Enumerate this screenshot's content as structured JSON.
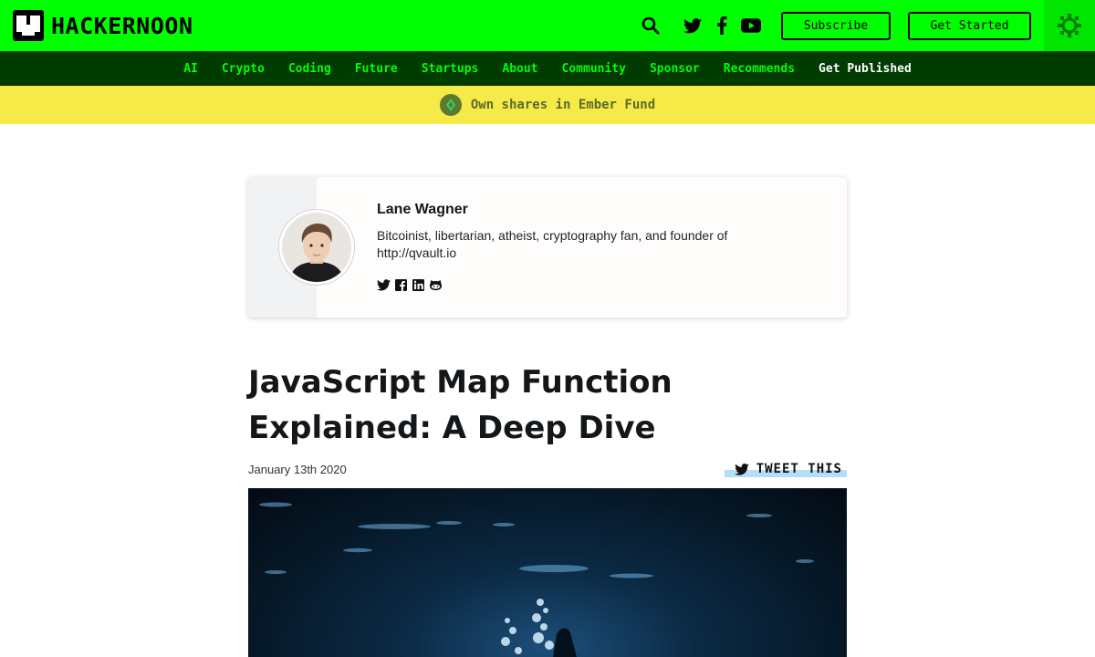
{
  "header": {
    "logo_text": "HACKERNOON",
    "icons": [
      "search-icon",
      "twitter-icon",
      "facebook-icon",
      "youtube-icon"
    ],
    "subscribe_label": "Subscribe",
    "get_started_label": "Get Started",
    "theme_icon": "sun-icon",
    "colors": {
      "brand": "#00ff00",
      "nav_bg": "#003b00",
      "promo_bg": "#f5ea47"
    }
  },
  "nav": {
    "items": [
      {
        "label": "AI"
      },
      {
        "label": "Crypto"
      },
      {
        "label": "Coding"
      },
      {
        "label": "Future"
      },
      {
        "label": "Startups"
      },
      {
        "label": "About"
      },
      {
        "label": "Community"
      },
      {
        "label": "Sponsor"
      },
      {
        "label": "Recommends"
      },
      {
        "label": "Get Published"
      }
    ]
  },
  "promo": {
    "icon": "ember-fund-icon",
    "text": "Own shares in Ember Fund"
  },
  "author": {
    "name": "Lane Wagner",
    "bio": "Bitcoinist, libertarian, atheist, cryptography fan, and founder of http://qvault.io",
    "social_icons": [
      "twitter-icon",
      "facebook-icon",
      "linkedin-icon",
      "github-icon"
    ]
  },
  "article": {
    "title": "JavaScript Map Function Explained: A Deep Dive",
    "date": "January 13th 2020",
    "tweet_label": "TWEET THIS"
  }
}
